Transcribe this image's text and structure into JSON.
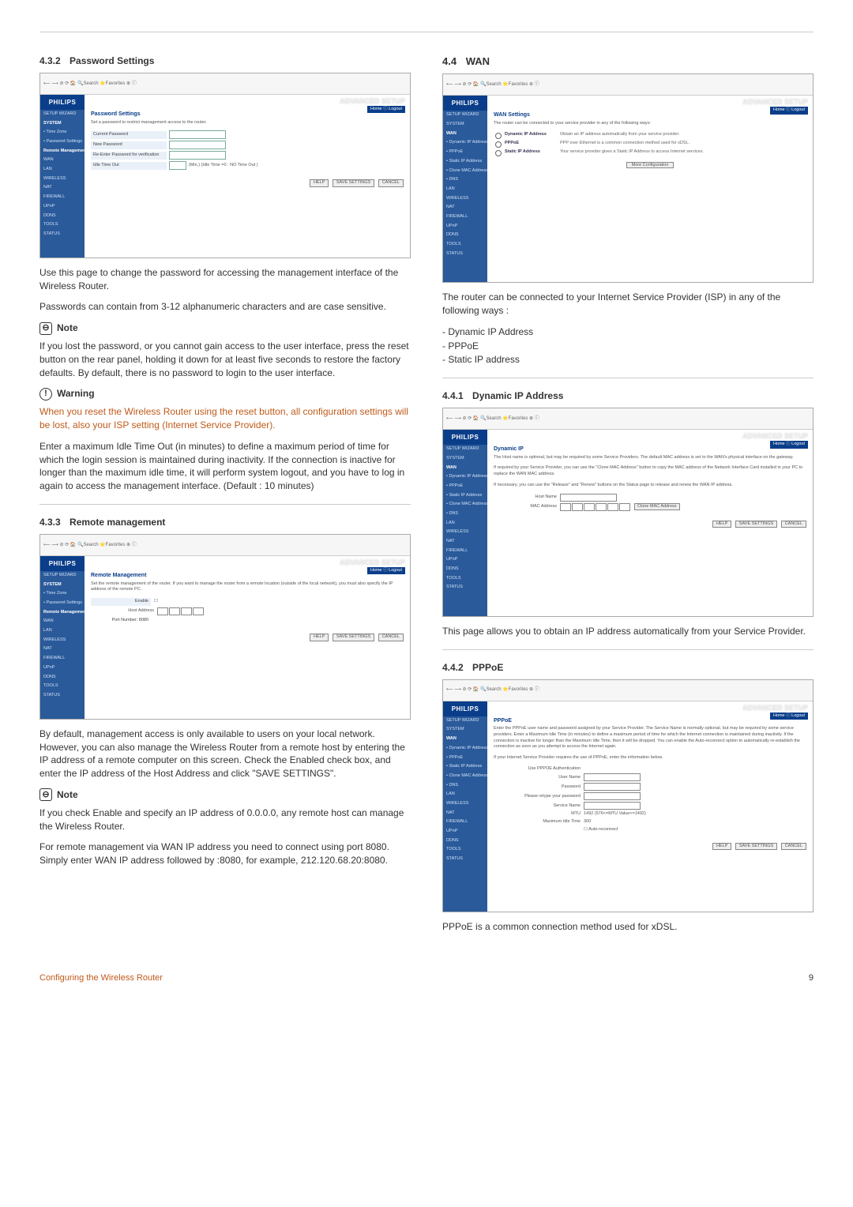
{
  "sections": {
    "s432": {
      "num": "4.3.2",
      "title": "Password Settings"
    },
    "s44": {
      "num": "4.4",
      "title": "WAN"
    },
    "s433": {
      "num": "4.3.3",
      "title": "Remote management"
    },
    "s441": {
      "num": "4.4.1",
      "title": "Dynamic IP Address"
    },
    "s442": {
      "num": "4.4.2",
      "title": "PPPoE"
    }
  },
  "left": {
    "p1": "Use this page to change the password for accessing the management interface of the Wireless Router.",
    "p2": "Passwords can contain from 3-12 alphanumeric characters and are case sensitive.",
    "noteLabel": "Note",
    "noteText": "If you lost the password, or you cannot gain access to the user interface, press the reset button on the rear panel, holding it down for at least five seconds to restore the factory defaults. By default, there is no password to login to the user interface.",
    "warnLabel": "Warning",
    "warnText": "When you reset the Wireless Router using the reset button, all configuration settings will be lost, also your ISP setting (Internet Service Provider).",
    "p3": "Enter a maximum Idle Time Out (in minutes) to define a maximum period of time for which the login session is maintained during inactivity. If the connection is inactive for longer than the maximum idle time, it will perform system logout, and you have to log in again to access the management interface. (Default : 10 minutes)",
    "remoteP1": "By default, management access is only available to users on your local network. However, you can also manage the Wireless Router from a remote host by entering the IP address of a remote computer on this screen. Check the Enabled check box, and enter the IP address of the Host Address and click \"SAVE SETTINGS\".",
    "note2Label": "Note",
    "note2Text": "If you check Enable and specify an IP address of 0.0.0.0, any remote host can manage the Wireless Router.",
    "remoteP2": "For remote management via WAN IP address you need to connect using port 8080. Simply enter WAN IP address followed by :8080, for example, 212.120.68.20:8080."
  },
  "right": {
    "wanP1": "The router can be connected to your Internet Service Provider (ISP) in any of the following ways :",
    "wanList": [
      "Dynamic IP Address",
      "PPPoE",
      "Static IP address"
    ],
    "dynP": "This page allows you to obtain an IP address automatically from your Service Provider.",
    "pppoeP": "PPPoE is a common connection method used for xDSL."
  },
  "shots": {
    "logo": "PHILIPS",
    "adv": "ADVANCED SETUP",
    "tabs": "Home  ⓘ Logout",
    "sidebar": [
      "SETUP WIZARD",
      "SYSTEM",
      "• Time Zone",
      "• Password Settings",
      "Remote Management",
      "WAN",
      "LAN",
      "WIRELESS",
      "NAT",
      "FIREWALL",
      "UPnP",
      "DDNS",
      "TOOLS",
      "STATUS"
    ],
    "sidebarWan": [
      "SETUP WIZARD",
      "SYSTEM",
      "WAN",
      "• Dynamic IP Address",
      "• PPPoE",
      "• Static IP Address",
      "• Clone MAC Address",
      "• DNS",
      "LAN",
      "WIRELESS",
      "NAT",
      "FIREWALL",
      "UPnP",
      "DDNS",
      "TOOLS",
      "STATUS"
    ],
    "browser": "⟵  ⟶  ⊘  ⟳  🏠   🔍Search  ⭐Favorites  ⊕  ⓘ",
    "btnHelp": "HELP",
    "btnSave": "SAVE SETTINGS",
    "btnCancel": "CANCEL",
    "pw": {
      "title": "Password Settings",
      "desc": "Set a password to restrict management access to the router.",
      "row1": "Current Password",
      "row2": "New Password",
      "row3": "Re-Enter Password for verification",
      "row4": "Idle Time Out",
      "row4txt": "(Min.) (Idle Time =0 : NO Time Out )"
    },
    "wan": {
      "title": "WAN Settings",
      "desc": "The router can be connected to your service provider in any of the following ways:",
      "opt1": "Dynamic IP Address",
      "opt1d": "Obtain an IP address automatically from your service provider.",
      "opt2": "PPPoE",
      "opt2d": "PPP over Ethernet is a common connection method used for xDSL.",
      "opt3": "Static IP Address",
      "opt3d": "Your service provider gives a Static IP Address to access Internet services.",
      "more": "More Configuration"
    },
    "remote": {
      "title": "Remote Management",
      "desc": "Set the remote management of the router. If you want to manage the router from a remote location (outside of the local network), you must also specify the IP address of the remote PC.",
      "row1": "Enable",
      "row2": "Host Address",
      "row3": "Port Number: 8080"
    },
    "dyn": {
      "title": "Dynamic IP",
      "d1": "The Host name is optional, but may be required by some Service Providers. The default MAC address is set to the WAN's physical interface on the gateway.",
      "d2": "If required by your Service Provider, you can use the \"Clone MAC Address\" button to copy the MAC address of the Network Interface Card installed in your PC to replace the WAN MAC address.",
      "d3": "If necessary, you can use the \"Release\" and \"Renew\" buttons on the Status page to release and renew the WAN IP address.",
      "host": "Host Name",
      "mac": "MAC Address",
      "clone": "Clone MAC Address"
    },
    "pppoe": {
      "title": "PPPoE",
      "desc": "Enter the PPPoE user name and password assigned by your Service Provider. The Service Name is normally optional, but may be required by some service providers. Enter a Maximum Idle Time (in minutes) to define a maximum period of time for which the Internet connection is maintained during inactivity. If the connection is inactive for longer than the Maximum Idle Time, then it will be dropped. You can enable the Auto-reconnect option to automatically re-establish the connection as soon as you attempt to access the Internet again.",
      "desc2": "If your Internet Service Provider requires the use of PPPoE, enter the information below.",
      "authTitle": "Use PPPOE Authentication",
      "userLbl": "User Name",
      "passLbl": "Password",
      "retypeLbl": "Please retype your password",
      "svcLbl": "Service Name",
      "mtuLbl": "MTU",
      "mtuVal": "1492  (576<=MTU Value<=1492)",
      "idleLbl": "Maximum Idle Time",
      "idleVal": "300",
      "autoLbl": "☐ Auto-reconnect"
    }
  },
  "footer": {
    "left": "Configuring the Wireless Router",
    "right": "9"
  }
}
